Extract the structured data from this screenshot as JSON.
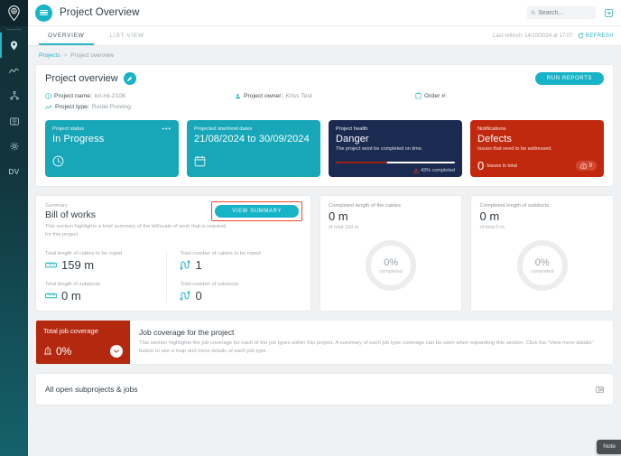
{
  "sidebar": {
    "logo": "location-pin-logo",
    "items": [
      {
        "name": "sidebar-item-projects",
        "icon": "map-pin-icon",
        "active": true
      },
      {
        "name": "sidebar-item-analytics",
        "icon": "trend-line-icon",
        "active": false
      },
      {
        "name": "sidebar-item-network",
        "icon": "network-hierarchy-icon",
        "active": false
      },
      {
        "name": "sidebar-item-library",
        "icon": "book-icon",
        "active": false
      },
      {
        "name": "sidebar-item-settings",
        "icon": "gear-icon",
        "active": false
      }
    ],
    "user_initials": "DV"
  },
  "header": {
    "title": "Project Overview",
    "menu_icon": "hamburger-icon",
    "search_placeholder": "Search...",
    "search_value": "",
    "search_icon": "search-icon",
    "logout_icon": "logout-icon"
  },
  "tabs": [
    {
      "label": "OVERVIEW",
      "active": true
    },
    {
      "label": "LIST VIEW",
      "active": false
    }
  ],
  "refresh": {
    "meta": "Last refresh: 14/10/2024 at 17:07",
    "label": "REFRESH",
    "icon": "refresh-icon"
  },
  "breadcrumb": {
    "root": "Projects",
    "separator": ">",
    "current": "Project overview"
  },
  "overview": {
    "title": "Project overview",
    "edit_icon": "pencil-icon",
    "run_reports_label": "RUN REPORTS",
    "meta": [
      {
        "icon": "info-circle-icon",
        "label": "Project name:",
        "value": "kri-mi-2108"
      },
      {
        "icon": "person-icon",
        "label": "Project owner:",
        "value": "Kriss Test"
      },
      {
        "icon": "clipboard-icon",
        "label": "Order #:",
        "value": ""
      },
      {
        "icon": "trend-line-icon",
        "label": "Project type:",
        "value": "Route Proving"
      }
    ]
  },
  "tiles": [
    {
      "name": "project-status",
      "label": "Project status",
      "value": "In Progress",
      "icon": "clock-icon",
      "menu_icon": "ellipsis-icon",
      "color": "#17a7b8"
    },
    {
      "name": "projected-dates",
      "label": "Projected start/end dates",
      "value": "21/08/2024 to 30/09/2024",
      "icon": "calendar-icon",
      "color": "#17a7b8"
    },
    {
      "name": "project-health",
      "label": "Project health",
      "value": "Danger",
      "sub": "The project wont be completed on time.",
      "progress_percent": 43,
      "progress_caption": "43% completed",
      "warning_icon": "warning-triangle-icon",
      "color": "#1b2a50",
      "progress_color": "#9b1f12"
    },
    {
      "name": "notifications",
      "label": "Notifications",
      "value": "Defects",
      "sub": "Issues that need to be addressed.",
      "issues_count": "0",
      "issues_text": "Issues in total",
      "badge_icon": "alert-house-icon",
      "badge_count": "0",
      "color": "#c1290f"
    }
  ],
  "bill_of_works": {
    "eyebrow": "Summary",
    "title": "Bill of works",
    "description": "This section highlights a brief summary of the bill/scale of work that is required for this project.",
    "view_summary_label": "VIEW SUMMARY",
    "highlight_color": "#ef4a2a",
    "stats": [
      {
        "label": "Total length of cables to be roped",
        "value": "159 m",
        "icon": "ruler-icon"
      },
      {
        "label": "Total length of subducts",
        "value": "0 m",
        "icon": "ruler-icon"
      },
      {
        "label": "Total number of cables to be roped",
        "value": "1",
        "icon": "cable-icon"
      },
      {
        "label": "Total number of subducts",
        "value": "0",
        "icon": "cable-icon"
      }
    ]
  },
  "donuts": [
    {
      "name": "completed-cables",
      "label": "Completed length of the cables",
      "value": "0 m",
      "sub": "of total 159 m",
      "percent": "0%",
      "percent_caption": "completed"
    },
    {
      "name": "completed-subducts",
      "label": "Completed length of subducts",
      "value": "0 m",
      "sub": "of total 0 m",
      "percent": "0%",
      "percent_caption": "completed"
    }
  ],
  "job_coverage": {
    "badge_title": "Total job coverage",
    "badge_percent": "0%",
    "badge_icon": "alert-bell-icon",
    "expand_icon": "chevron-down-icon",
    "heading": "Job coverage for the project",
    "description": "This section highlights the job coverage for each of the job types within this project. A summary of each job type coverage can be seen when expanding this section. Click the \"View more details\" button to see a map and more details of each job type."
  },
  "subprojects": {
    "title": "All open subprojects & jobs",
    "view_icon": "list-view-icon"
  },
  "note_tab": {
    "label": "Note"
  }
}
